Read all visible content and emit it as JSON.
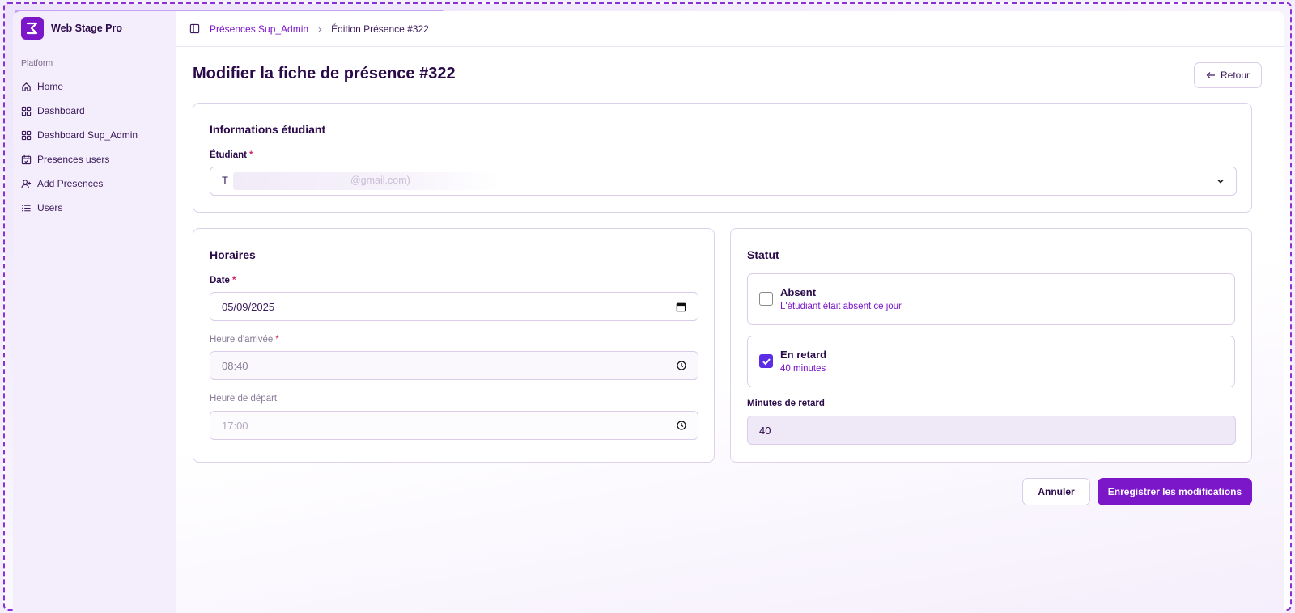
{
  "sidebar": {
    "brand": "Web Stage Pro",
    "group_label": "Platform",
    "items": [
      {
        "label": "Home",
        "icon": "home-icon"
      },
      {
        "label": "Dashboard",
        "icon": "grid-icon"
      },
      {
        "label": "Dashboard Sup_Admin",
        "icon": "grid-icon"
      },
      {
        "label": "Presences users",
        "icon": "calendar-check-icon"
      },
      {
        "label": "Add Presences",
        "icon": "user-plus-icon"
      },
      {
        "label": "Users",
        "icon": "list-icon"
      }
    ]
  },
  "breadcrumb": {
    "parent": "Présences Sup_Admin",
    "current": "Édition Présence #322"
  },
  "page": {
    "title": "Modifier la fiche de présence #322",
    "back_label": "Retour"
  },
  "student_card": {
    "title": "Informations étudiant",
    "student_label": "Étudiant",
    "required_mark": "*",
    "student_value_start": "T",
    "student_value_end": "@gmail.com)"
  },
  "schedule_card": {
    "title": "Horaires",
    "date_label": "Date",
    "date_value": "05/09/2025",
    "arrival_label": "Heure d'arrivée",
    "arrival_value": "08:40",
    "departure_label": "Heure de départ",
    "departure_value": "17:00"
  },
  "status_card": {
    "title": "Statut",
    "absent": {
      "name": "Absent",
      "desc": "L'étudiant était absent ce jour",
      "checked": false
    },
    "late": {
      "name": "En retard",
      "desc": "40 minutes",
      "checked": true
    },
    "minutes_label": "Minutes de retard",
    "minutes_value": "40"
  },
  "actions": {
    "cancel_label": "Annuler",
    "save_label": "Enregistrer les modifications"
  },
  "colors": {
    "accent": "#7b16c9",
    "checkbox": "#5b2ee6",
    "required": "#d4246a"
  }
}
